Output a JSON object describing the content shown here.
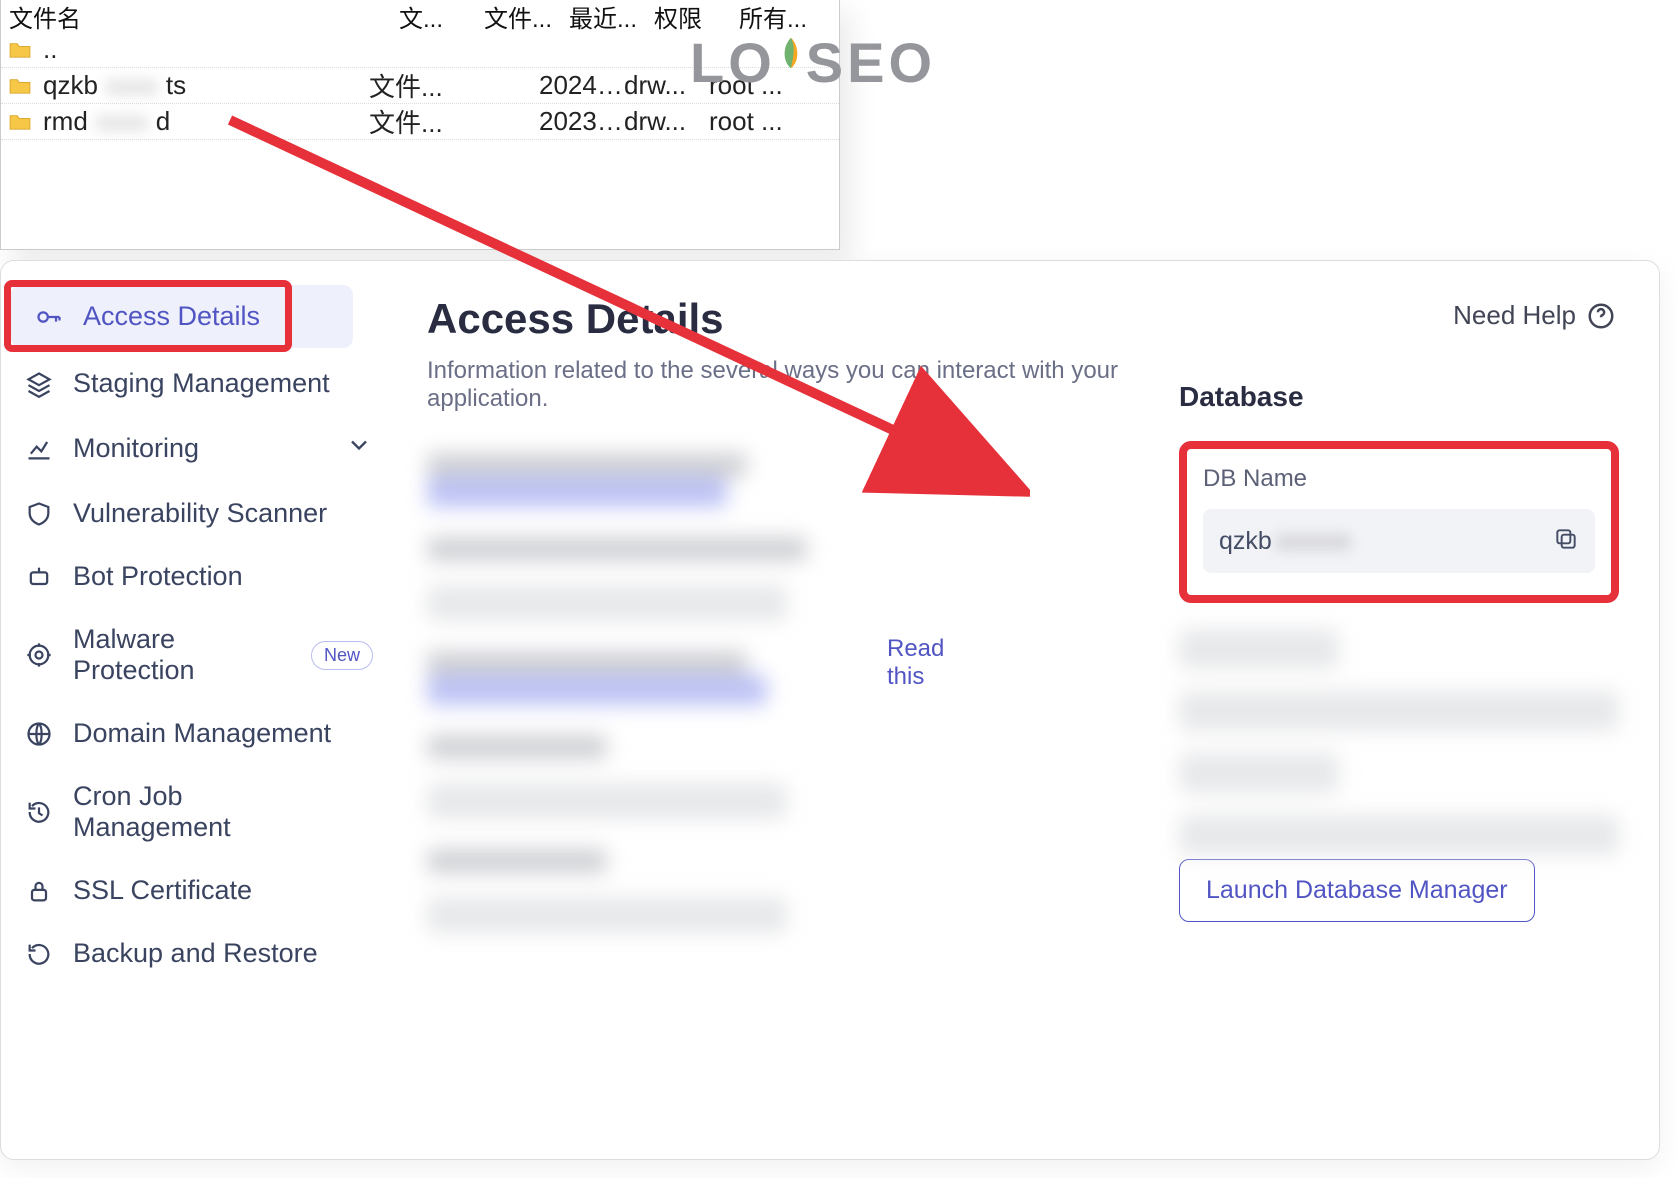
{
  "watermark": {
    "pre": "LO",
    "post": "SEO"
  },
  "file_browser": {
    "headers": {
      "name": "文件名",
      "type": "文...",
      "size": "文件...",
      "modified": "最近...",
      "perm": "权限",
      "owner": "所有..."
    },
    "rows": [
      {
        "name": "..",
        "type": "",
        "size": "",
        "modified": "",
        "perm": "",
        "owner": ""
      },
      {
        "name_pre": "qzkb",
        "name_blur": "xxxx",
        "name_post": "ts",
        "type": "文件...",
        "size": "",
        "modified": "2024/...",
        "perm": "drw...",
        "owner": "root ..."
      },
      {
        "name_pre": "rmd",
        "name_blur": "xxxx",
        "name_post": "d",
        "type": "文件...",
        "size": "",
        "modified": "2023/...",
        "perm": "drw...",
        "owner": "root ..."
      }
    ]
  },
  "sidebar": {
    "items": [
      {
        "label": "Access Details"
      },
      {
        "label": "Staging Management"
      },
      {
        "label": "Monitoring"
      },
      {
        "label": "Vulnerability Scanner"
      },
      {
        "label": "Bot Protection"
      },
      {
        "label": "Malware Protection",
        "badge": "New"
      },
      {
        "label": "Domain Management"
      },
      {
        "label": "Cron Job Management"
      },
      {
        "label": "SSL Certificate"
      },
      {
        "label": "Backup and Restore"
      }
    ]
  },
  "page": {
    "title": "Access Details",
    "subtitle": "Information related to the several ways you can interact with your application.",
    "help": "Need Help",
    "read_this": "Read this"
  },
  "database": {
    "section_title": "Database",
    "name_label": "DB Name",
    "name_value_pre": "qzkb",
    "name_value_blur": "xxxxxx",
    "launch_label": "Launch Database Manager"
  }
}
